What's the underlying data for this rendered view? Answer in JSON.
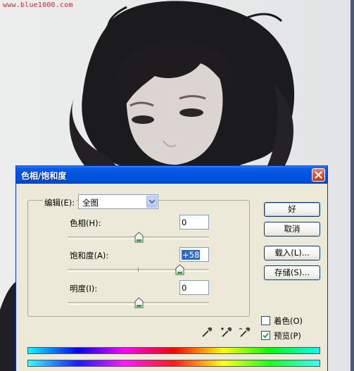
{
  "watermark": "www.blue1000.com",
  "dialog": {
    "title": "色相/饱和度",
    "edit_label": "编辑(E):",
    "edit_value": "全图",
    "hue": {
      "label": "色相(H):",
      "value": "0"
    },
    "saturation": {
      "label": "饱和度(A):",
      "value": "+58"
    },
    "lightness": {
      "label": "明度(I):",
      "value": "0"
    },
    "buttons": {
      "ok": "好",
      "cancel": "取消",
      "load": "载入(L)...",
      "save": "存储(S)..."
    },
    "colorize": {
      "label": "着色(O)",
      "checked": false
    },
    "preview": {
      "label": "预览(P)",
      "checked": true
    },
    "slider_levels": {
      "hue": 0,
      "saturation": 58,
      "lightness": 0
    }
  },
  "colors": {
    "titlebar": "#0054e3",
    "dialog_bg": "#ece9d8",
    "selection": "#316ac5",
    "close": "#d9542f"
  },
  "icons": [
    "close-icon",
    "dropdown-arrow-icon",
    "eyedropper-icon",
    "eyedropper-plus-icon",
    "eyedropper-minus-icon",
    "checkmark-icon"
  ]
}
